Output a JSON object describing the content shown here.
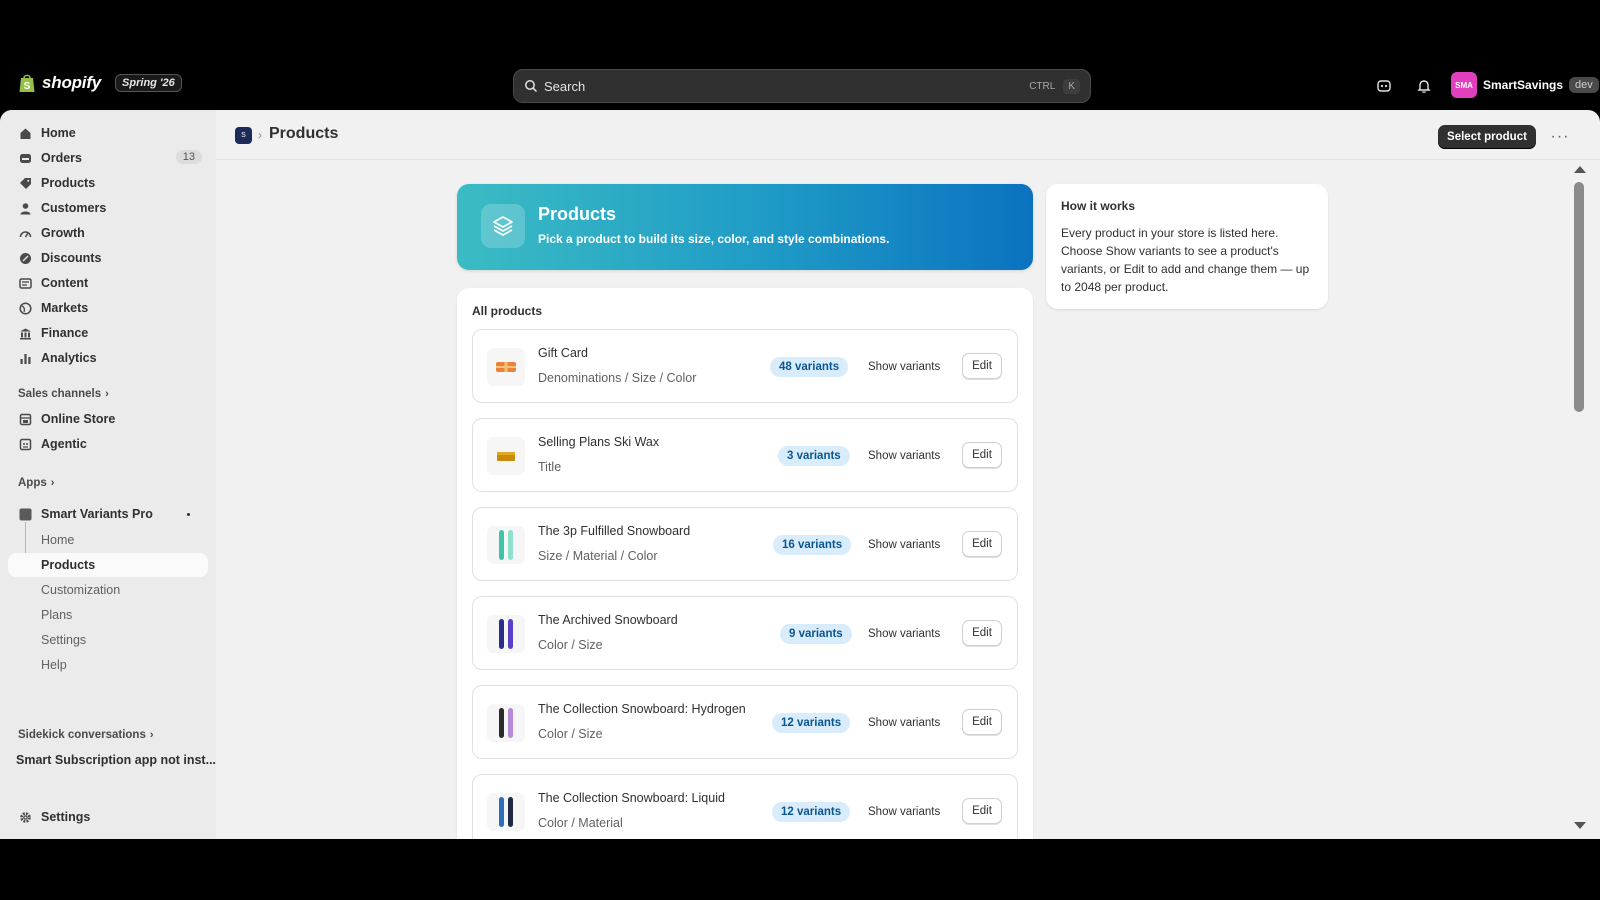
{
  "topbar": {
    "brand": "shopify",
    "edition": "Spring '26",
    "search_placeholder": "Search",
    "shortcut_ctrl": "CTRL",
    "shortcut_key": "K",
    "user_initials": "SMA",
    "user_name": "SmartSavings",
    "user_badge": "dev",
    "avatar_color": "#e23fbe"
  },
  "sidebar": {
    "items": [
      {
        "label": "Home",
        "icon": "home-icon"
      },
      {
        "label": "Orders",
        "icon": "orders-icon",
        "count": "13"
      },
      {
        "label": "Products",
        "icon": "tag-icon"
      },
      {
        "label": "Customers",
        "icon": "person-icon"
      },
      {
        "label": "Growth",
        "icon": "growth-icon"
      },
      {
        "label": "Discounts",
        "icon": "discount-icon"
      },
      {
        "label": "Content",
        "icon": "content-icon"
      },
      {
        "label": "Markets",
        "icon": "globe-icon"
      },
      {
        "label": "Finance",
        "icon": "bank-icon"
      },
      {
        "label": "Analytics",
        "icon": "bar-chart-icon"
      }
    ],
    "sales_channels_label": "Sales channels",
    "channels": [
      {
        "label": "Online Store",
        "icon": "store-icon"
      },
      {
        "label": "Agentic",
        "icon": "agentic-icon"
      }
    ],
    "apps_label": "Apps",
    "app_name": "Smart Variants Pro",
    "app_subitems": [
      "Home",
      "Products",
      "Customization",
      "Plans",
      "Settings",
      "Help"
    ],
    "sidekick_label": "Sidekick conversations",
    "sidekick_item": "Smart Subscription app not inst...",
    "settings_label": "Settings"
  },
  "page": {
    "title": "Products",
    "app_icon_text": "S",
    "primary_action": "Select product",
    "more_label": "···"
  },
  "hero": {
    "title": "Products",
    "subtitle": "Pick a product to build its size, color, and style combinations."
  },
  "products_card": {
    "title": "All products",
    "show_label": "Show variants",
    "edit_label": "Edit",
    "rows": [
      {
        "name": "Gift Card",
        "options": "Denominations / Size / Color",
        "variants": "48 variants",
        "thumb": "gift-card-icon"
      },
      {
        "name": "Selling Plans Ski Wax",
        "options": "Title",
        "variants": "3 variants",
        "thumb": "ski-wax-icon"
      },
      {
        "name": "The 3p Fulfilled Snowboard",
        "options": "Size / Material / Color",
        "variants": "16 variants",
        "thumb": "snowboard-icon"
      },
      {
        "name": "The Archived Snowboard",
        "options": "Color / Size",
        "variants": "9 variants",
        "thumb": "snowboard-icon"
      },
      {
        "name": "The Collection Snowboard: Hydrogen",
        "options": "Color / Size",
        "variants": "12 variants",
        "thumb": "snowboard-icon"
      },
      {
        "name": "The Collection Snowboard: Liquid",
        "options": "Color / Material",
        "variants": "12 variants",
        "thumb": "snowboard-icon"
      }
    ]
  },
  "how_it_works": {
    "title": "How it works",
    "body": "Every product in your store is listed here. Choose Show variants to see a product's variants, or Edit to add and change them — up to 2048 per product."
  },
  "colors": {
    "hero_gradient_start": "#3bbcc4",
    "hero_gradient_end": "#0b72c0",
    "badge_bg": "#d8ecfb",
    "badge_text": "#0b5691"
  }
}
